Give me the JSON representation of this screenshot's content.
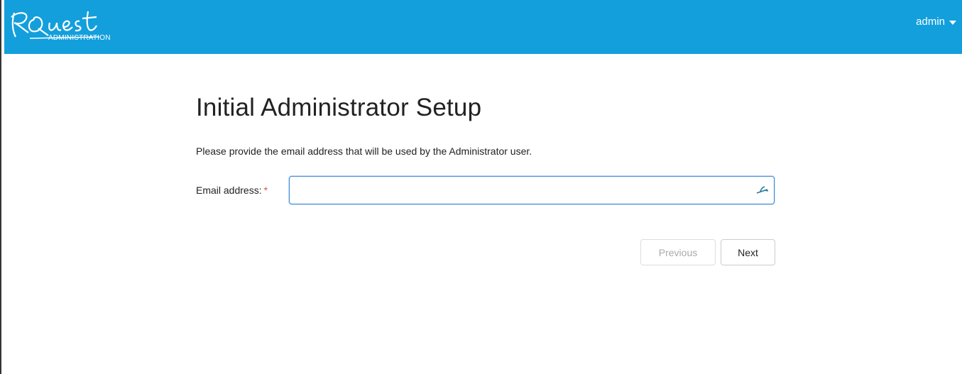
{
  "header": {
    "logo_text": "RQuest",
    "logo_subtitle": "ADMINISTRATION",
    "user_menu_label": "admin",
    "brand_color": "#139fdc"
  },
  "main": {
    "title": "Initial Administrator Setup",
    "description": "Please provide the email address that will be used by the Administrator user.",
    "email_label": "Email address:",
    "required_marker": "*",
    "email_value": "",
    "email_icon": "autofill-key-icon"
  },
  "actions": {
    "previous_label": "Previous",
    "next_label": "Next"
  }
}
